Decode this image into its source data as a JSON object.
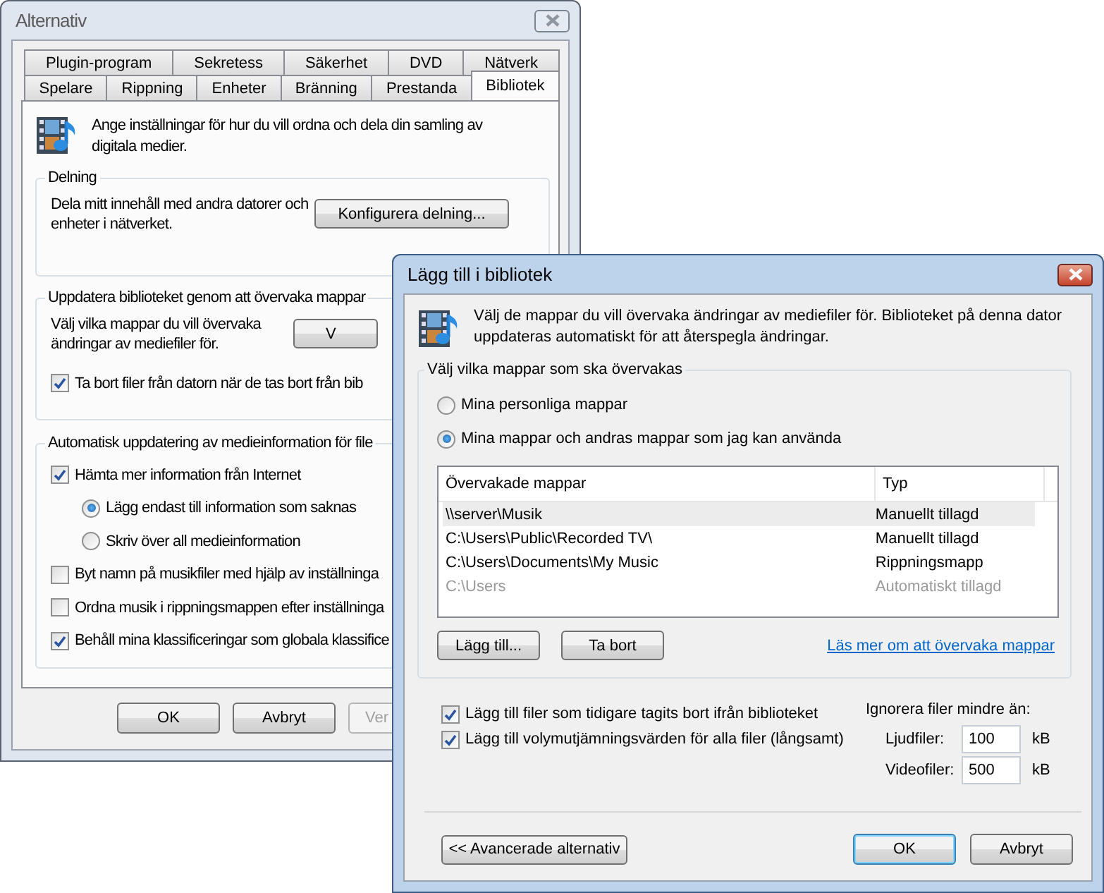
{
  "options_window": {
    "title": "Alternativ",
    "active": false,
    "tab_rows": [
      [
        {
          "label": "Plugin-program",
          "selected": false
        },
        {
          "label": "Sekretess",
          "selected": false
        },
        {
          "label": "Säkerhet",
          "selected": false
        },
        {
          "label": "DVD",
          "selected": false
        },
        {
          "label": "Nätverk",
          "selected": false
        }
      ],
      [
        {
          "label": "Spelare",
          "selected": false
        },
        {
          "label": "Rippning",
          "selected": false
        },
        {
          "label": "Enheter",
          "selected": false
        },
        {
          "label": "Bränning",
          "selected": false
        },
        {
          "label": "Prestanda",
          "selected": false
        },
        {
          "label": "Bibliotek",
          "selected": true
        }
      ]
    ],
    "intro": "Ange inställningar för hur du vill ordna och dela din samling av digitala medier.",
    "sharing": {
      "title": "Delning",
      "text": "Dela mitt innehåll med andra datorer och enheter i nätverket.",
      "button": "Konfigurera delning..."
    },
    "monitor": {
      "title": "Uppdatera biblioteket genom att övervaka mappar",
      "text": "Välj vilka mappar du vill övervaka ändringar av mediefiler för.",
      "button": "V",
      "option": {
        "label": "Ta bort filer från datorn när de tas bort från bib",
        "checked": true
      }
    },
    "auto_update": {
      "title": "Automatisk uppdatering av medieinformation för file",
      "items": [
        {
          "kind": "checkbox",
          "label": "Hämta mer information från Internet",
          "checked": true
        },
        {
          "kind": "radio",
          "label": "Lägg endast till information som saknas",
          "selected": true
        },
        {
          "kind": "radio",
          "label": "Skriv över all medieinformation",
          "selected": false
        },
        {
          "kind": "checkbox",
          "label": "Byt namn på musikfiler med hjälp av inställninga",
          "checked": false
        },
        {
          "kind": "checkbox",
          "label": "Ordna musik i rippningsmappen efter inställninga",
          "checked": false
        },
        {
          "kind": "checkbox",
          "label": "Behåll mina klassificeringar som globala klassifice",
          "checked": true
        }
      ]
    },
    "buttons": [
      {
        "label": "OK",
        "disabled": false
      },
      {
        "label": "Avbryt",
        "disabled": false
      },
      {
        "label": "Ver",
        "disabled": true
      }
    ]
  },
  "library_dialog": {
    "title": "Lägg till i bibliotek",
    "active": true,
    "intro": "Välj de mappar du vill övervaka ändringar av mediefiler för. Biblioteket på denna dator uppdateras automatiskt för att återspegla ändringar.",
    "group_title": "Välj vilka mappar som ska övervakas",
    "scope": [
      {
        "label": "Mina personliga mappar",
        "selected": false
      },
      {
        "label": "Mina mappar och andras mappar som jag kan använda",
        "selected": true
      }
    ],
    "table": {
      "columns": [
        "Övervakade mappar",
        "Typ"
      ],
      "rows": [
        {
          "folder": "\\\\server\\Musik",
          "type": "Manuellt tillagd",
          "selected": true,
          "disabled": false
        },
        {
          "folder": "C:\\Users\\Public\\Recorded TV\\",
          "type": "Manuellt tillagd",
          "selected": false,
          "disabled": false
        },
        {
          "folder": "C:\\Users\\Documents\\My Music",
          "type": "Rippningsmapp",
          "selected": false,
          "disabled": false
        },
        {
          "folder": "C:\\Users",
          "type": "Automatiskt tillagd",
          "selected": false,
          "disabled": true
        }
      ]
    },
    "add_button": "Lägg till...",
    "remove_button": "Ta bort",
    "help_link": "Läs mer om att övervaka mappar",
    "options": [
      {
        "label": "Lägg till filer som tidigare tagits bort ifrån biblioteket",
        "checked": true
      },
      {
        "label": "Lägg till volymutjämningsvärden för alla filer (långsamt)",
        "checked": true
      }
    ],
    "ignore": {
      "title": "Ignorera filer mindre än:",
      "fields": [
        {
          "label": "Ljudfiler:",
          "value": "100",
          "unit": "kB"
        },
        {
          "label": "Videofiler:",
          "value": "500",
          "unit": "kB"
        }
      ]
    },
    "advanced_button": "<< Avancerade alternativ",
    "buttons": [
      {
        "label": "OK",
        "default": true
      },
      {
        "label": "Avbryt",
        "default": false
      }
    ]
  }
}
